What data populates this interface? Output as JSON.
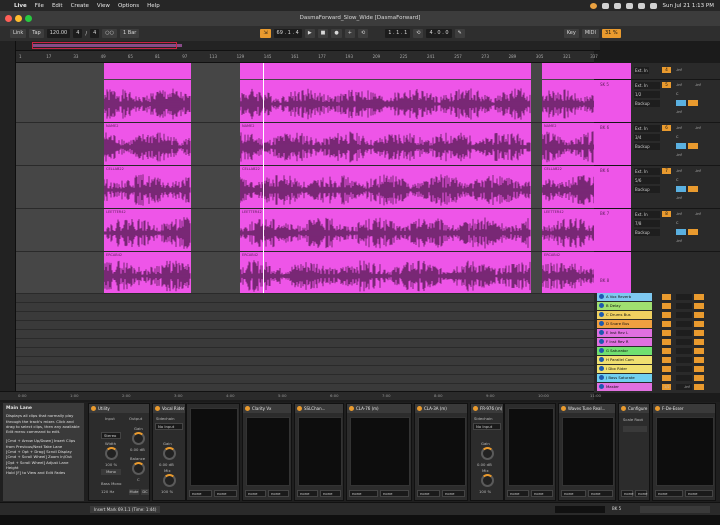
{
  "menubar": {
    "items": [
      "Live",
      "File",
      "Edit",
      "Create",
      "View",
      "Options",
      "Help"
    ],
    "clock": "Sun Jul 21  1:13 PM"
  },
  "window": {
    "title": "DasmaForward_Slow_Wide  [DasmaForward]"
  },
  "control_bar": {
    "link": "Link",
    "tap": "Tap",
    "tempo": "120.00",
    "time_sig_num": "4",
    "time_sig_den": "4",
    "metronome": "○○",
    "quant": "1 Bar",
    "position": "69 .  1 .  4",
    "loop_start": "1 .  1 .  1",
    "loop_len": "4 .  0 .  0",
    "key": "Key",
    "midi": "MIDI",
    "cpu": "31 %"
  },
  "ruler": {
    "bars": [
      "1",
      "17",
      "33",
      "49",
      "65",
      "81",
      "97",
      "113",
      "129",
      "145",
      "161",
      "177",
      "193",
      "209",
      "225",
      "241",
      "257",
      "273",
      "289",
      "305",
      "321",
      "337"
    ]
  },
  "timebar": {
    "times": [
      "0:00",
      "1:00",
      "2:00",
      "3:00",
      "4:00",
      "5:00",
      "6:00",
      "7:00",
      "8:00",
      "9:00",
      "10:00",
      "11:00"
    ]
  },
  "tracks": [
    {
      "clip_label": "NAME2",
      "mini": "SK 5",
      "input": "Ext. In",
      "ch": "1/2",
      "monitor": "Backup",
      "num": "5",
      "vol": "-inf",
      "pan": "C"
    },
    {
      "clip_label": "CELLAB22",
      "mini": "BK 6",
      "input": "Ext. In",
      "ch": "3/4",
      "monitor": "Backup",
      "num": "6",
      "vol": "-inf",
      "pan": "C"
    },
    {
      "clip_label": "LEETTER42",
      "mini": "BK 6",
      "input": "Ext. In",
      "ch": "5/6",
      "monitor": "Backup",
      "num": "7",
      "vol": "-inf",
      "pan": "C"
    },
    {
      "clip_label": "ERCAB42",
      "mini": "BK 7",
      "input": "Ext. In",
      "ch": "7/8",
      "monitor": "Backup",
      "num": "8",
      "vol": "-inf",
      "pan": "C"
    }
  ],
  "top_track": {
    "input": "Ext. In",
    "vol": "-inf",
    "num": "4"
  },
  "bottom_clip_label": "AUX42",
  "bottom_mini": "BK 8",
  "returns": [
    {
      "name": "A Vox Reverb",
      "color": "#7ec8f0"
    },
    {
      "name": "B Delay",
      "color": "#a0e070"
    },
    {
      "name": "C Drums Bus",
      "color": "#f0d060"
    },
    {
      "name": "D Snare Bus",
      "color": "#f0a040"
    },
    {
      "name": "E Inst Rev L",
      "color": "#e070e0"
    },
    {
      "name": "F Inst Rev R",
      "color": "#e070e0"
    },
    {
      "name": "G Saturator",
      "color": "#70e070"
    },
    {
      "name": "H Parallel Com",
      "color": "#f0e070"
    },
    {
      "name": "I Dbx Rider",
      "color": "#f0e070"
    },
    {
      "name": "J Bass Saturate",
      "color": "#70d0f0"
    },
    {
      "name": "Master",
      "color": "#e070e0"
    }
  ],
  "master": {
    "ratio": "1/2",
    "vol": "-inf"
  },
  "help": {
    "title": "Main Lane",
    "body": "Displays all clips that normally play through the track's mixer. Click and drag to select clips, then any available Edit menu command to edit.",
    "shortcuts": "[Cmd + Arrow Up/Down] Insert Clips from Previous/Next Take Lane\n[Cmd + Opt + Drag] Scroll Display\n[Cmd + Scroll Wheel] Zoom In/Out\n[Opt + Scroll Wheel] Adjust Lane Height\nHold [F] to View and Edit Fades"
  },
  "devices": [
    {
      "name": "Utility",
      "input": "Input",
      "output": "Output",
      "mode": "Stereo",
      "width_label": "Width",
      "width": "100 %",
      "mono": "Mono",
      "bass_mono": "Bass Mono",
      "bass_freq": "120 Hz",
      "gain_label": "Gain",
      "gain": "0.00 dB",
      "balance": "Balance",
      "balance_val": "C",
      "mute": "Mute",
      "dc": "DC"
    },
    {
      "name": "Vocal Rider (m)",
      "sidechain": "Sidechain",
      "sc_input": "No Input",
      "gain_label": "Gain",
      "gain": "0.00 dB",
      "mix": "Mix",
      "mix_val": "100 %"
    },
    {
      "name": "Clarity Vx"
    },
    {
      "name": "SSLChan..."
    },
    {
      "name": "CLA-76 (m)"
    },
    {
      "name": "CLA-3A (m)"
    },
    {
      "name": "FR-976 (m)",
      "sidechain": "Sidechain",
      "sc_input": "No Input",
      "gain_label": "Gain",
      "gain": "0.00 dB",
      "mix": "Mix",
      "mix_val": "100 %"
    },
    {
      "name": "Waves Tune Real..."
    },
    {
      "name": "Configure",
      "scale_root": "Scale Root"
    },
    {
      "name": "F-De-Esser"
    }
  ],
  "none_label": "none",
  "status": {
    "text": "Insert Mark 69.1.1 (Time: 1:44)",
    "track": "BK 5"
  }
}
